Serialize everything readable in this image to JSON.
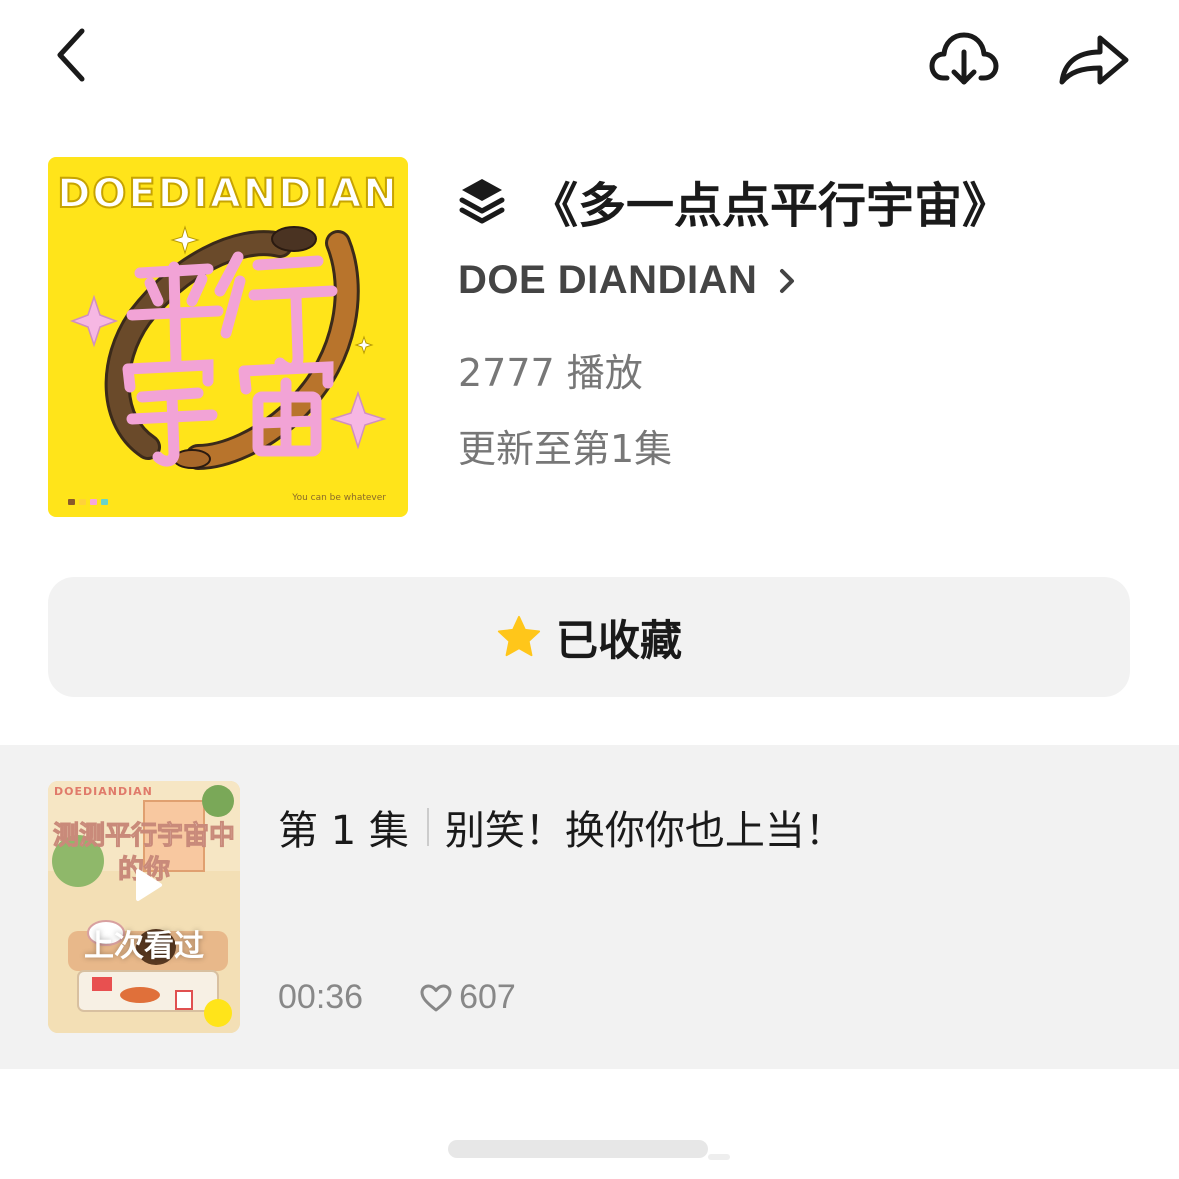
{
  "header": {
    "back_icon": "chevron-left-icon",
    "download_icon": "cloud-download-icon",
    "share_icon": "share-arrow-icon"
  },
  "album": {
    "cover": {
      "brand": "DOEDIANDIAN",
      "title_art": "平行宇宙",
      "tagline": "You can be whatever",
      "background": "#ffe41a"
    },
    "title": "《多一点点平行宇宙》",
    "title_icon": "layers-icon",
    "author": "DOE DIANDIAN",
    "plays": "2777 播放",
    "update": "更新至第1集"
  },
  "favorite": {
    "label": "已收藏",
    "icon": "star-icon",
    "star_color": "#ffc61a"
  },
  "episode": {
    "thumb_brand": "DOEDIANDIAN",
    "thumb_title": "测测平行宇宙中的你",
    "thumb_badge": "上次看过",
    "number": "第 1 集",
    "title": "别笑！换你你也上当！",
    "duration": "00:36",
    "likes": "607"
  }
}
